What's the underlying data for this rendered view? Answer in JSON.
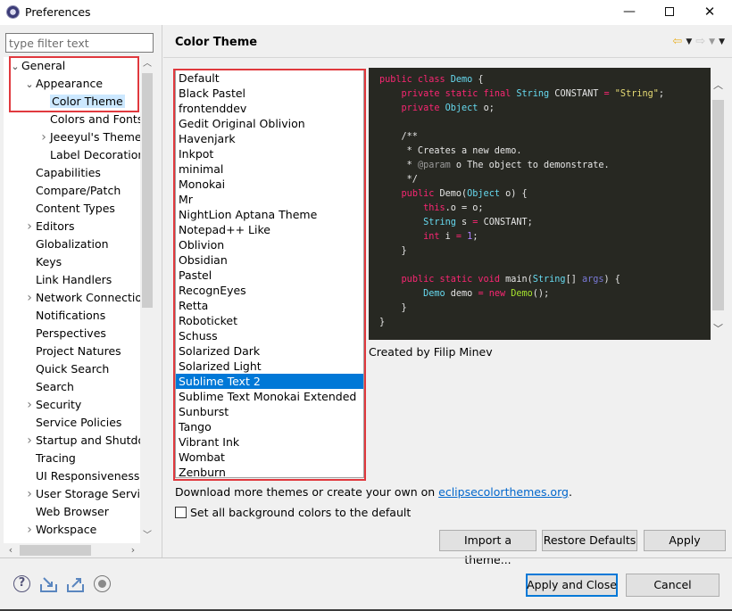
{
  "window": {
    "title": "Preferences",
    "minimize": "—",
    "close": "✕"
  },
  "filter": {
    "placeholder": "type filter text",
    "value": ""
  },
  "tree": {
    "items": [
      {
        "label": "General",
        "depth": 0,
        "toggle": "expanded"
      },
      {
        "label": "Appearance",
        "depth": 1,
        "toggle": "expanded"
      },
      {
        "label": "Color Theme",
        "depth": 2,
        "toggle": "none",
        "selected": true
      },
      {
        "label": "Colors and Fonts",
        "depth": 2,
        "toggle": "none"
      },
      {
        "label": "Jeeeyul's Themes",
        "depth": 2,
        "toggle": "collapsed"
      },
      {
        "label": "Label Decorations",
        "depth": 2,
        "toggle": "none"
      },
      {
        "label": "Capabilities",
        "depth": 1,
        "toggle": "none"
      },
      {
        "label": "Compare/Patch",
        "depth": 1,
        "toggle": "none"
      },
      {
        "label": "Content Types",
        "depth": 1,
        "toggle": "none"
      },
      {
        "label": "Editors",
        "depth": 1,
        "toggle": "collapsed"
      },
      {
        "label": "Globalization",
        "depth": 1,
        "toggle": "none"
      },
      {
        "label": "Keys",
        "depth": 1,
        "toggle": "none"
      },
      {
        "label": "Link Handlers",
        "depth": 1,
        "toggle": "none"
      },
      {
        "label": "Network Connections",
        "depth": 1,
        "toggle": "collapsed"
      },
      {
        "label": "Notifications",
        "depth": 1,
        "toggle": "none"
      },
      {
        "label": "Perspectives",
        "depth": 1,
        "toggle": "none"
      },
      {
        "label": "Project Natures",
        "depth": 1,
        "toggle": "none"
      },
      {
        "label": "Quick Search",
        "depth": 1,
        "toggle": "none"
      },
      {
        "label": "Search",
        "depth": 1,
        "toggle": "none"
      },
      {
        "label": "Security",
        "depth": 1,
        "toggle": "collapsed"
      },
      {
        "label": "Service Policies",
        "depth": 1,
        "toggle": "none"
      },
      {
        "label": "Startup and Shutdown",
        "depth": 1,
        "toggle": "collapsed"
      },
      {
        "label": "Tracing",
        "depth": 1,
        "toggle": "none"
      },
      {
        "label": "UI Responsiveness",
        "depth": 1,
        "toggle": "none"
      },
      {
        "label": "User Storage Service",
        "depth": 1,
        "toggle": "collapsed"
      },
      {
        "label": "Web Browser",
        "depth": 1,
        "toggle": "none"
      },
      {
        "label": "Workspace",
        "depth": 1,
        "toggle": "collapsed"
      }
    ]
  },
  "page": {
    "title": "Color Theme",
    "themes": [
      "Default",
      "Black Pastel",
      "frontenddev",
      "Gedit Original Oblivion",
      "Havenjark",
      "Inkpot",
      "minimal",
      "Monokai",
      "Mr",
      "NightLion Aptana Theme",
      "Notepad++ Like",
      "Oblivion",
      "Obsidian",
      "Pastel",
      "RecognEyes",
      "Retta",
      "Roboticket",
      "Schuss",
      "Solarized Dark",
      "Solarized Light",
      "Sublime Text 2",
      "Sublime Text Monokai Extended",
      "Sunburst",
      "Tango",
      "Vibrant Ink",
      "Wombat",
      "Zenburn"
    ],
    "selected_theme": "Sublime Text 2",
    "preview_code": [
      [
        [
          "kw",
          "public class "
        ],
        [
          "ty",
          "Demo"
        ],
        [
          "cm",
          " {"
        ]
      ],
      [
        [
          "cm",
          "    "
        ],
        [
          "kw",
          "private static final "
        ],
        [
          "ty",
          "String"
        ],
        [
          "cm",
          " CONSTANT "
        ],
        [
          "kw",
          "="
        ],
        [
          "cm",
          " "
        ],
        [
          "st",
          "\"String\""
        ],
        [
          "cm",
          ";"
        ]
      ],
      [
        [
          "cm",
          "    "
        ],
        [
          "kw",
          "private "
        ],
        [
          "ty",
          "Object"
        ],
        [
          "cm",
          " o;"
        ]
      ],
      [
        [
          "cm",
          ""
        ]
      ],
      [
        [
          "cm",
          "    /**"
        ]
      ],
      [
        [
          "cm",
          "     * Creates a new demo."
        ]
      ],
      [
        [
          "cm",
          "     * "
        ],
        [
          "an",
          "@param"
        ],
        [
          "cm",
          " o The object to demonstrate."
        ]
      ],
      [
        [
          "cm",
          "     */"
        ]
      ],
      [
        [
          "cm",
          "    "
        ],
        [
          "kw",
          "public "
        ],
        [
          "cm",
          "Demo("
        ],
        [
          "ty",
          "Object"
        ],
        [
          "cm",
          " o) {"
        ]
      ],
      [
        [
          "cm",
          "        "
        ],
        [
          "kw",
          "this"
        ],
        [
          "cm",
          ".o = o;"
        ]
      ],
      [
        [
          "cm",
          "        "
        ],
        [
          "ty",
          "String"
        ],
        [
          "cm",
          " s "
        ],
        [
          "kw",
          "="
        ],
        [
          "cm",
          " CONSTANT;"
        ]
      ],
      [
        [
          "cm",
          "        "
        ],
        [
          "kw",
          "int"
        ],
        [
          "cm",
          " i "
        ],
        [
          "kw",
          "="
        ],
        [
          "cm",
          " "
        ],
        [
          "nm",
          "1"
        ],
        [
          "cm",
          ";"
        ]
      ],
      [
        [
          "cm",
          "    }"
        ]
      ],
      [
        [
          "cm",
          ""
        ]
      ],
      [
        [
          "cm",
          "    "
        ],
        [
          "kw",
          "public static void "
        ],
        [
          "cm",
          "main("
        ],
        [
          "ty",
          "String"
        ],
        [
          "cm",
          "[] "
        ],
        [
          "pr",
          "args"
        ],
        [
          "cm",
          ") {"
        ]
      ],
      [
        [
          "cm",
          "        "
        ],
        [
          "ty",
          "Demo"
        ],
        [
          "cm",
          " demo "
        ],
        [
          "kw",
          "= new "
        ],
        [
          "fn",
          "Demo"
        ],
        [
          "cm",
          "();"
        ]
      ],
      [
        [
          "cm",
          "    }"
        ]
      ],
      [
        [
          "cm",
          "}"
        ]
      ]
    ],
    "author": "Created by Filip Minev",
    "download_prefix": "Download more themes or create your own on ",
    "download_link": "eclipsecolorthemes.org",
    "download_suffix": ".",
    "checkbox_label": "Set all background colors to the default",
    "checkbox_checked": false,
    "buttons": {
      "import": "Import a theme...",
      "restore": "Restore Defaults",
      "apply": "Apply"
    }
  },
  "footer": {
    "apply_close": "Apply and Close",
    "cancel": "Cancel"
  },
  "colors": {
    "selection": "#0078d7",
    "tree_selection": "#cce8ff",
    "highlight_box": "#e0393e",
    "preview_bg": "#272822",
    "link": "#0066cc"
  }
}
